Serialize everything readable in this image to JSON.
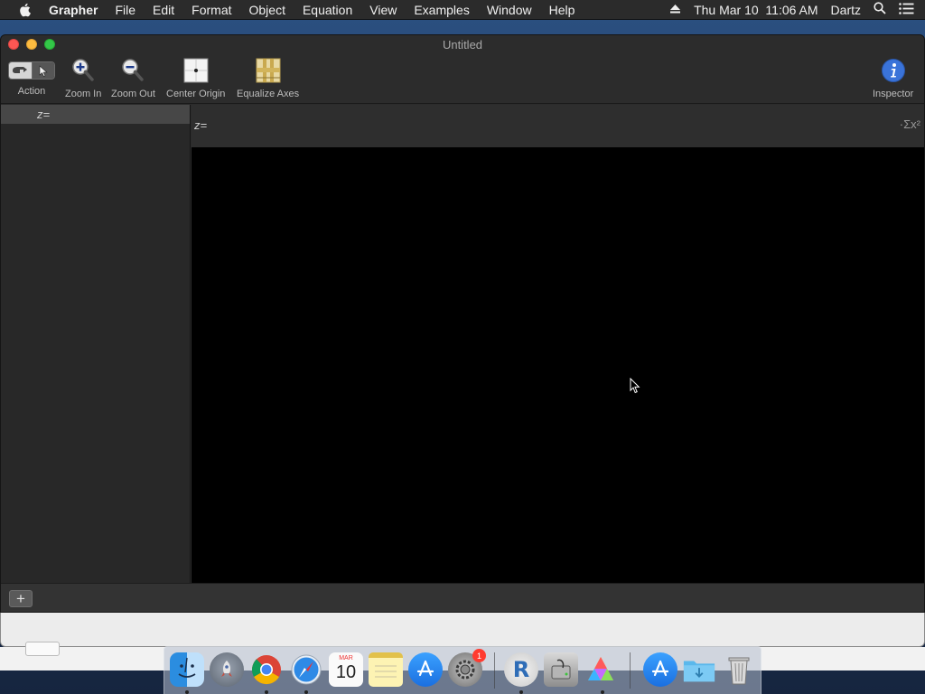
{
  "menubar": {
    "app": "Grapher",
    "items": [
      "File",
      "Edit",
      "Format",
      "Object",
      "Equation",
      "View",
      "Examples",
      "Window",
      "Help"
    ],
    "datetime": "Thu Mar 10  11:06 AM",
    "user": "Dartz"
  },
  "window": {
    "title": "Untitled",
    "toolbar": {
      "action": "Action",
      "zoom_in": "Zoom In",
      "zoom_out": "Zoom Out",
      "center_origin": "Center Origin",
      "equalize_axes": "Equalize Axes",
      "inspector": "Inspector"
    },
    "sidebar": {
      "equation": "z="
    },
    "equation_bar": {
      "equation": "z=",
      "symbol": "·Σx²"
    },
    "add_label": "+"
  },
  "dock": {
    "calendar_month": "MAR",
    "calendar_day": "10",
    "badge": "1"
  },
  "colors": {
    "close": "#fc5753",
    "minimize": "#fdbc40",
    "maximize": "#33c748",
    "inspector": "#3a73d9"
  }
}
